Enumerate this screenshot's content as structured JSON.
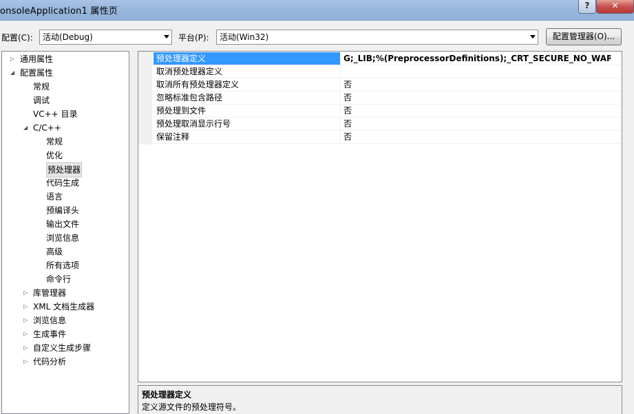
{
  "window": {
    "title": "onsoleApplication1 属性页",
    "help_label": "?",
    "close_label": "✕"
  },
  "toolbar": {
    "config_label": "配置(C):",
    "config_value": "活动(Debug)",
    "platform_label": "平台(P):",
    "platform_value": "活动(Win32)",
    "config_manager_label": "配置管理器(O)..."
  },
  "tree": {
    "items": [
      {
        "label": "通用属性",
        "level": 0,
        "expander": "collapsed"
      },
      {
        "label": "配置属性",
        "level": 0,
        "expander": "expanded"
      },
      {
        "label": "常规",
        "level": 1,
        "expander": "none"
      },
      {
        "label": "调试",
        "level": 1,
        "expander": "none"
      },
      {
        "label": "VC++ 目录",
        "level": 1,
        "expander": "none"
      },
      {
        "label": "C/C++",
        "level": 1,
        "expander": "expanded"
      },
      {
        "label": "常规",
        "level": 2,
        "expander": "none"
      },
      {
        "label": "优化",
        "level": 2,
        "expander": "none"
      },
      {
        "label": "预处理器",
        "level": 2,
        "expander": "none",
        "selected": true
      },
      {
        "label": "代码生成",
        "level": 2,
        "expander": "none"
      },
      {
        "label": "语言",
        "level": 2,
        "expander": "none"
      },
      {
        "label": "预编译头",
        "level": 2,
        "expander": "none"
      },
      {
        "label": "输出文件",
        "level": 2,
        "expander": "none"
      },
      {
        "label": "浏览信息",
        "level": 2,
        "expander": "none"
      },
      {
        "label": "高级",
        "level": 2,
        "expander": "none"
      },
      {
        "label": "所有选项",
        "level": 2,
        "expander": "none"
      },
      {
        "label": "命令行",
        "level": 2,
        "expander": "none"
      },
      {
        "label": "库管理器",
        "level": 1,
        "expander": "collapsed"
      },
      {
        "label": "XML 文档生成器",
        "level": 1,
        "expander": "collapsed"
      },
      {
        "label": "浏览信息",
        "level": 1,
        "expander": "collapsed"
      },
      {
        "label": "生成事件",
        "level": 1,
        "expander": "collapsed"
      },
      {
        "label": "自定义生成步骤",
        "level": 1,
        "expander": "collapsed"
      },
      {
        "label": "代码分析",
        "level": 1,
        "expander": "collapsed"
      }
    ]
  },
  "properties": {
    "rows": [
      {
        "name": "预处理器定义",
        "value": "G;_LIB;%(PreprocessorDefinitions);_CRT_SECURE_NO_WARNINGS",
        "selected": true
      },
      {
        "name": "取消预处理器定义",
        "value": ""
      },
      {
        "name": "取消所有预处理器定义",
        "value": "否"
      },
      {
        "name": "忽略标准包含路径",
        "value": "否"
      },
      {
        "name": "预处理到文件",
        "value": "否"
      },
      {
        "name": "预处理取消显示行号",
        "value": "否"
      },
      {
        "name": "保留注释",
        "value": "否"
      }
    ]
  },
  "description": {
    "title": "预处理器定义",
    "text": "定义源文件的预处理符号。"
  },
  "icons": {
    "expander_collapsed": "triangle-right-icon",
    "expander_expanded": "triangle-down-icon",
    "dropdown": "chevron-down-icon"
  },
  "colors": {
    "selection": "#3399ff",
    "titlebar": "#9bb8dd",
    "close": "#c75050"
  }
}
